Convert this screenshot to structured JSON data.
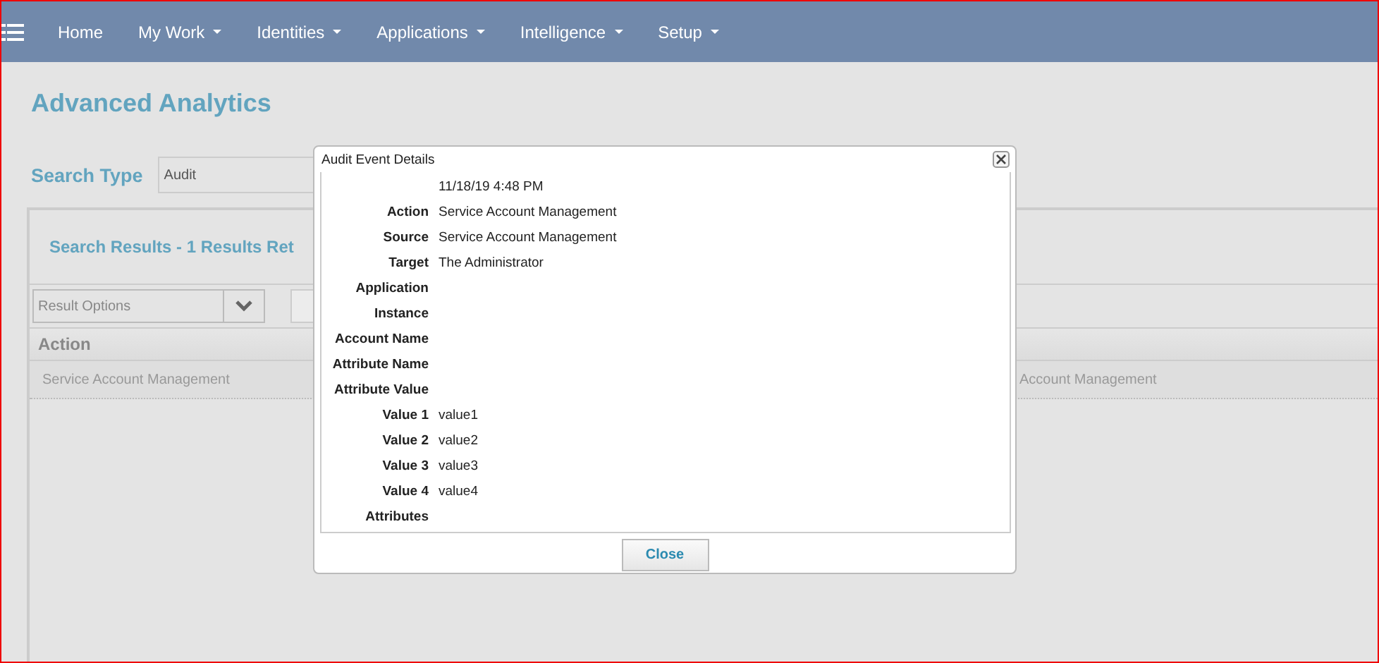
{
  "nav": {
    "items": [
      {
        "label": "Home",
        "dropdown": false
      },
      {
        "label": "My Work",
        "dropdown": true
      },
      {
        "label": "Identities",
        "dropdown": true
      },
      {
        "label": "Applications",
        "dropdown": true
      },
      {
        "label": "Intelligence",
        "dropdown": true
      },
      {
        "label": "Setup",
        "dropdown": true
      }
    ]
  },
  "page_title": "Advanced Analytics",
  "search": {
    "label": "Search Type",
    "value": "Audit"
  },
  "results": {
    "heading": "Search Results - 1 Results Ret",
    "options_placeholder": "Result Options",
    "columns": [
      "Action"
    ],
    "row": {
      "left": "Service Account Management",
      "right": "Account Management"
    }
  },
  "dialog": {
    "title": "Audit Event Details",
    "rows": [
      {
        "value": "11/18/19 4:48 PM"
      },
      {
        "label": "Action",
        "value": "Service Account Management"
      },
      {
        "label": "Source",
        "value": "Service Account Management"
      },
      {
        "label": "Target",
        "value": "The Administrator"
      },
      {
        "label": "Application"
      },
      {
        "label": "Instance"
      },
      {
        "label": "Account Name"
      },
      {
        "label": "Attribute Name"
      },
      {
        "label": "Attribute Value"
      },
      {
        "label": "Value 1",
        "value": "value1"
      },
      {
        "label": "Value 2",
        "value": "value2"
      },
      {
        "label": "Value 3",
        "value": "value3"
      },
      {
        "label": "Value 4",
        "value": "value4"
      },
      {
        "label": "Attributes"
      }
    ],
    "close_button": "Close"
  }
}
